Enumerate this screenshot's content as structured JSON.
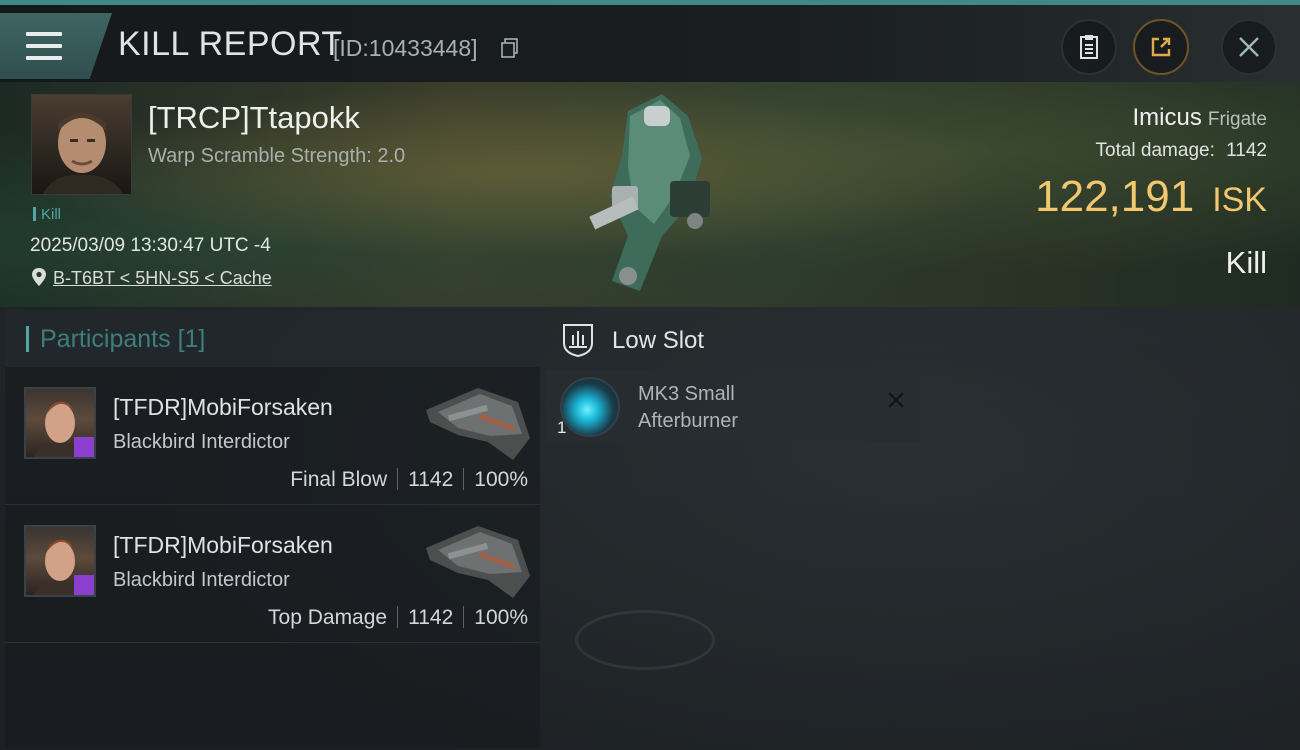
{
  "header": {
    "title": "KILL REPORT",
    "report_id": "[ID:10433448]"
  },
  "victim": {
    "name": "[TRCP]Ttapokk",
    "warp_scramble": "Warp Scramble Strength: 2.0",
    "kill_tag": "Kill",
    "datetime": "2025/03/09 13:30:47 UTC -4",
    "location": "B-T6BT < 5HN-S5 < Cache",
    "ship_name": "Imicus",
    "ship_class": "Frigate",
    "total_damage_label": "Total damage:",
    "total_damage": "1142",
    "isk_value": "122,191",
    "isk_unit": "ISK",
    "result": "Kill"
  },
  "participants": {
    "title": "Participants",
    "count": "[1]",
    "rows": [
      {
        "name": "[TFDR]MobiForsaken",
        "ship": "Blackbird Interdictor",
        "role": "Final Blow",
        "damage": "1142",
        "percent": "100%"
      },
      {
        "name": "[TFDR]MobiForsaken",
        "ship": "Blackbird Interdictor",
        "role": "Top Damage",
        "damage": "1142",
        "percent": "100%"
      }
    ]
  },
  "fitting": {
    "slot_title": "Low Slot",
    "modules": [
      {
        "qty": "1",
        "name_line1": "MK3 Small",
        "name_line2": "Afterburner"
      }
    ]
  },
  "colors": {
    "accent": "#4fa6a2",
    "isk": "#f2c76e",
    "badge": "#8a3fcf"
  }
}
